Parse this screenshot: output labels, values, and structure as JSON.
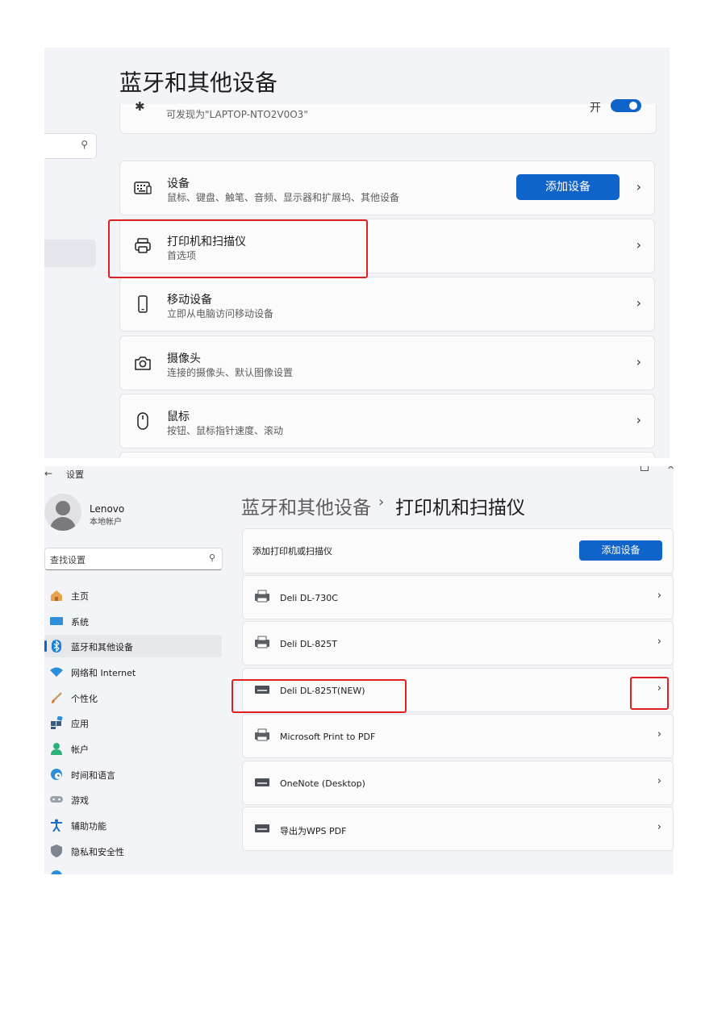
{
  "screen1": {
    "page_title": "蓝牙和其他设备",
    "bluetooth": {
      "subtitle": "可发现为\"LAPTOP-NTO2V0O3\"",
      "toggle_state": "开",
      "toggle_on": true
    },
    "cards": [
      {
        "title": "设备",
        "subtitle": "鼠标、键盘、触笔、音频、显示器和扩展坞、其他设备",
        "icon": "keyboard-icon",
        "button": "添加设备"
      },
      {
        "title": "打印机和扫描仪",
        "subtitle": "首选项",
        "icon": "printer-icon"
      },
      {
        "title": "移动设备",
        "subtitle": "立即从电脑访问移动设备",
        "icon": "phone-icon"
      },
      {
        "title": "摄像头",
        "subtitle": "连接的摄像头、默认图像设置",
        "icon": "camera-icon"
      },
      {
        "title": "鼠标",
        "subtitle": "按钮、鼠标指针速度、滚动",
        "icon": "mouse-icon"
      }
    ],
    "highlight_color": "#e02020"
  },
  "screen2": {
    "window_title": "设置",
    "user": {
      "name": "Lenovo",
      "account_type": "本地帐户"
    },
    "search_placeholder": "查找设置",
    "nav": [
      {
        "label": "主页",
        "icon": "home-icon"
      },
      {
        "label": "系统",
        "icon": "monitor-icon"
      },
      {
        "label": "蓝牙和其他设备",
        "icon": "bluetooth-icon",
        "selected": true
      },
      {
        "label": "网络和 Internet",
        "icon": "wifi-icon"
      },
      {
        "label": "个性化",
        "icon": "brush-icon"
      },
      {
        "label": "应用",
        "icon": "apps-icon"
      },
      {
        "label": "帐户",
        "icon": "account-icon"
      },
      {
        "label": "时间和语言",
        "icon": "globe-clock-icon"
      },
      {
        "label": "游戏",
        "icon": "gamepad-icon"
      },
      {
        "label": "辅助功能",
        "icon": "accessibility-icon"
      },
      {
        "label": "隐私和安全性",
        "icon": "shield-icon"
      }
    ],
    "breadcrumb": {
      "parent": "蓝牙和其他设备",
      "separator": "›",
      "current": "打印机和扫描仪"
    },
    "add_printer": {
      "label": "添加打印机或扫描仪",
      "button": "添加设备"
    },
    "printers": [
      {
        "name": "Deli DL-730C"
      },
      {
        "name": "Deli DL-825T"
      },
      {
        "name": "Deli DL-825T(NEW)",
        "highlighted": true
      },
      {
        "name": "Microsoft Print to PDF"
      },
      {
        "name": "OneNote (Desktop)"
      },
      {
        "name": "导出为WPS PDF"
      }
    ],
    "accent_color": "#1063c8"
  }
}
